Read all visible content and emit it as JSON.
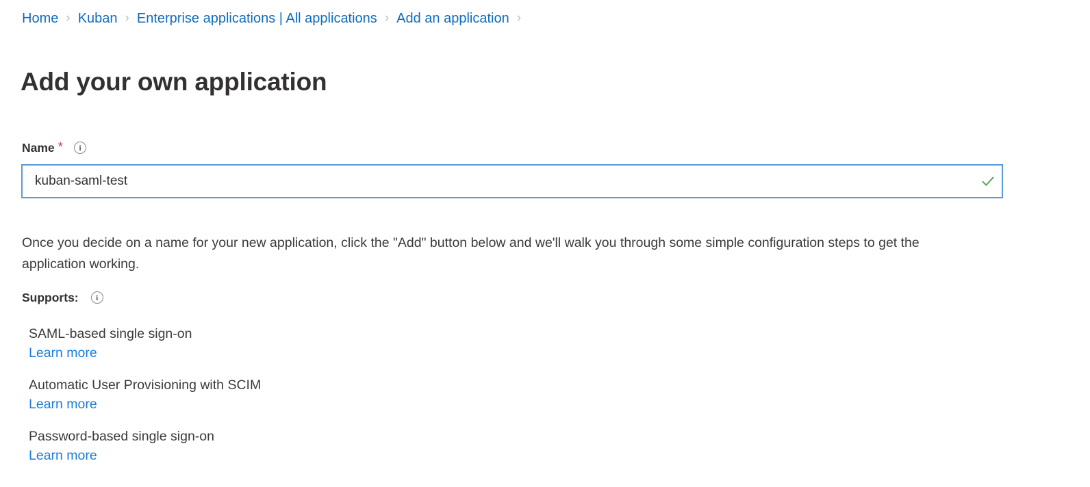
{
  "breadcrumb": {
    "separator": "›",
    "items": [
      {
        "label": "Home"
      },
      {
        "label": "Kuban"
      },
      {
        "label": "Enterprise applications | All applications"
      },
      {
        "label": "Add an application"
      }
    ],
    "trailing_separator": true
  },
  "page": {
    "title": "Add your own application"
  },
  "name_field": {
    "label": "Name",
    "required_marker": "*",
    "info_icon": "info-icon",
    "info_glyph": "i",
    "value": "kuban-saml-test",
    "placeholder": "",
    "validation_state": "valid",
    "validation_icon": "check-icon"
  },
  "description": {
    "text": "Once you decide on a name for your new application, click the \"Add\" button below and we'll walk you through some simple configuration steps to get the application working."
  },
  "supports": {
    "label": "Supports:",
    "info_icon": "info-icon",
    "info_glyph": "i",
    "items": [
      {
        "name": "SAML-based single sign-on",
        "link_label": "Learn more"
      },
      {
        "name": "Automatic User Provisioning with SCIM",
        "link_label": "Learn more"
      },
      {
        "name": "Password-based single sign-on",
        "link_label": "Learn more"
      }
    ]
  },
  "colors": {
    "link": "#0f6cbd",
    "learn_more_link": "#1a7ddb",
    "text": "#323130",
    "body_text": "#3b3a39",
    "required": "#cf3b4e",
    "focus_border": "#5b9bd5",
    "valid_check": "#5ca85c",
    "separator": "#bdbdbd",
    "background": "#ffffff"
  }
}
